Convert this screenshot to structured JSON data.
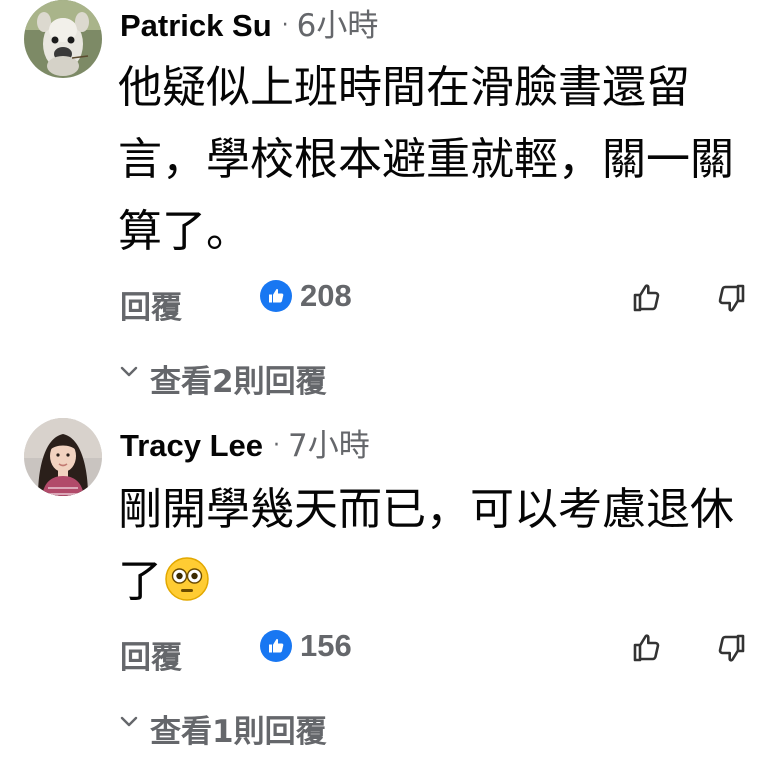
{
  "comments": [
    {
      "author": "Patrick Su",
      "separator": "·",
      "time": "6小時",
      "text": "他疑似上班時間在滑臉書還留言，學校根本避重就輕，關一關算了。",
      "emoji": "",
      "reply_label": "回覆",
      "like_count": "208",
      "view_replies_label": "查看2則回覆",
      "avatar_icon": "llama-avatar"
    },
    {
      "author": "Tracy Lee",
      "separator": "·",
      "time": "7小時",
      "text": "剛開學幾天而已，可以考慮退休了",
      "emoji": "flushed-face-emoji",
      "reply_label": "回覆",
      "like_count": "156",
      "view_replies_label": "查看1則回覆",
      "avatar_icon": "woman-portrait-avatar"
    }
  ],
  "colors": {
    "text_primary": "#050505",
    "text_secondary": "#65676b",
    "like_blue": "#1877f2"
  },
  "icons": {
    "like_badge": "thumbs-up-icon",
    "vote_up": "thumbs-up-outline-icon",
    "vote_down": "thumbs-down-outline-icon",
    "expand": "chevron-down-icon"
  }
}
